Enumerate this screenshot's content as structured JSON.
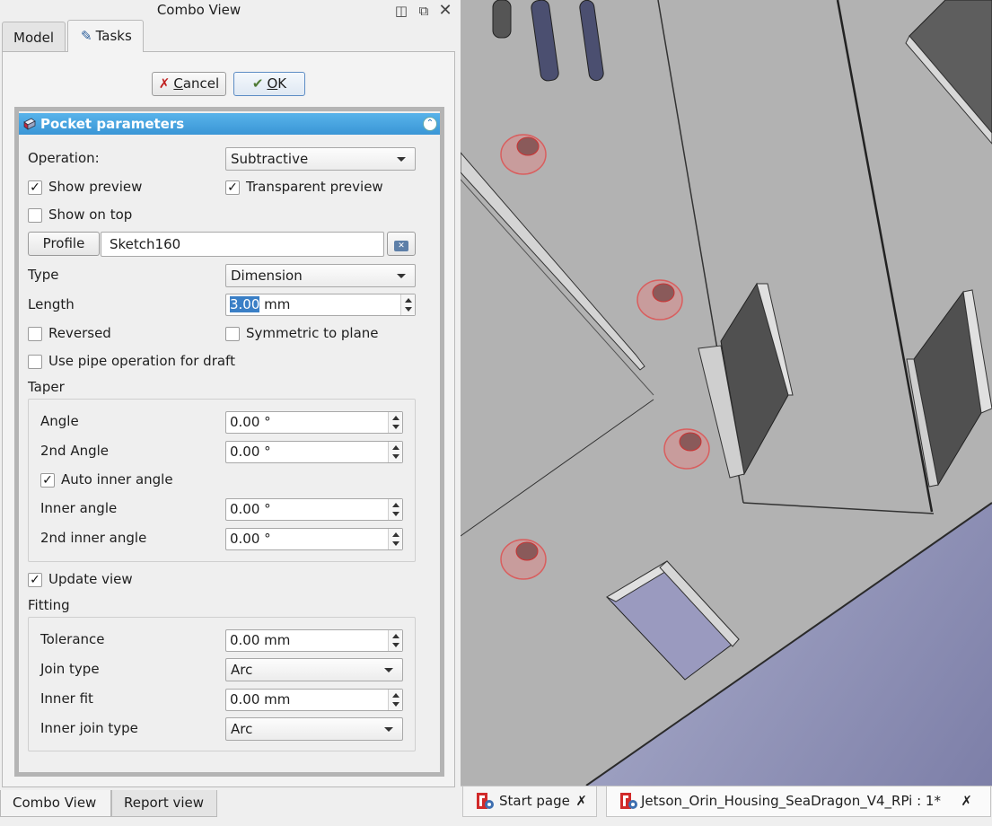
{
  "combo_view": {
    "title": "Combo View",
    "tabs": [
      {
        "label": "Model"
      },
      {
        "label": "Tasks"
      }
    ]
  },
  "dialog_buttons": {
    "cancel_first": "C",
    "cancel_rest": "ancel",
    "ok_first": "O",
    "ok_rest": "K"
  },
  "pocket": {
    "header": "Pocket parameters",
    "operation_label": "Operation:",
    "operation_value": "Subtractive",
    "show_preview_label": "Show preview",
    "show_preview_checked": true,
    "transparent_preview_label": "Transparent preview",
    "transparent_preview_checked": true,
    "show_on_top_label": "Show on top",
    "show_on_top_checked": false,
    "profile_button": "Profile",
    "profile_value": "Sketch160",
    "type_label": "Type",
    "type_value": "Dimension",
    "length_label": "Length",
    "length_number": "3.00",
    "length_unit": " mm",
    "reversed_label": "Reversed",
    "reversed_checked": false,
    "symmetric_label": "Symmetric to plane",
    "symmetric_checked": false,
    "pipe_draft_label": "Use pipe operation for draft",
    "pipe_draft_checked": false,
    "taper": {
      "title": "Taper",
      "angle_label": "Angle",
      "angle_value": "0.00 °",
      "angle2_label": "2nd Angle",
      "angle2_value": "0.00 °",
      "auto_inner_label": "Auto inner angle",
      "auto_inner_checked": true,
      "inner_angle_label": "Inner angle",
      "inner_angle_value": "0.00 °",
      "inner_angle2_label": "2nd inner angle",
      "inner_angle2_value": "0.00 °"
    },
    "update_view_label": "Update view",
    "update_view_checked": true,
    "fitting": {
      "title": "Fitting",
      "tolerance_label": "Tolerance",
      "tolerance_value": "0.00 mm",
      "join_type_label": "Join type",
      "join_type_value": "Arc",
      "inner_fit_label": "Inner fit",
      "inner_fit_value": "0.00 mm",
      "inner_join_label": "Inner join type",
      "inner_join_value": "Arc"
    }
  },
  "bottom_tabs": [
    {
      "label": "Combo View"
    },
    {
      "label": "Report view"
    }
  ],
  "document_tabs": [
    {
      "label": "Start page"
    },
    {
      "label": "Jetson_Orin_Housing_SeaDragon_V4_RPi : 1*"
    }
  ],
  "colors": {
    "header_blue": "#3a96d6",
    "selection_blue": "#3a7fc6",
    "model_gray": "#b4b4b4",
    "highlight_red": "#e05050"
  }
}
